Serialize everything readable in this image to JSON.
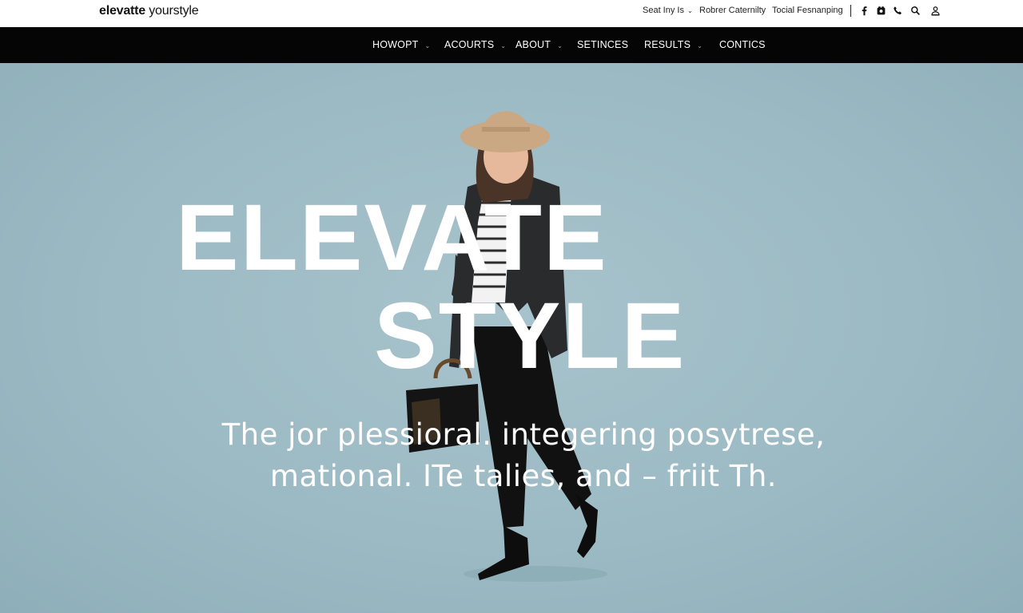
{
  "brand": {
    "bold": "elevatte",
    "light": " yourstyle"
  },
  "utility": {
    "select_label": "Seat Iny Is",
    "link1": "Robrer Caternilty",
    "link2": "Tocial Fesnanping"
  },
  "icons": [
    "facebook-icon",
    "instagram-icon",
    "phone-icon",
    "search-icon",
    "account-icon"
  ],
  "nav": {
    "items": [
      {
        "label": "HOWOPT",
        "has_dropdown": true
      },
      {
        "label": "ACOURTS",
        "has_dropdown": true
      },
      {
        "label": "ABOUT",
        "has_dropdown": true
      },
      {
        "label": "SETINCES",
        "has_dropdown": false
      },
      {
        "label": "RESULTS",
        "has_dropdown": true
      },
      {
        "label": "CONTICS",
        "has_dropdown": false
      }
    ]
  },
  "hero": {
    "title_line1": "ELEVATE",
    "title_line2": "STYLE",
    "tagline_line1": "The jor plessioral. integering posytrese,",
    "tagline_line2": "mational. ITe talies, and – friit Th."
  },
  "colors": {
    "nav_bg": "#050505",
    "hero_bg": "#9fbcc6",
    "hero_text": "#ffffff"
  }
}
